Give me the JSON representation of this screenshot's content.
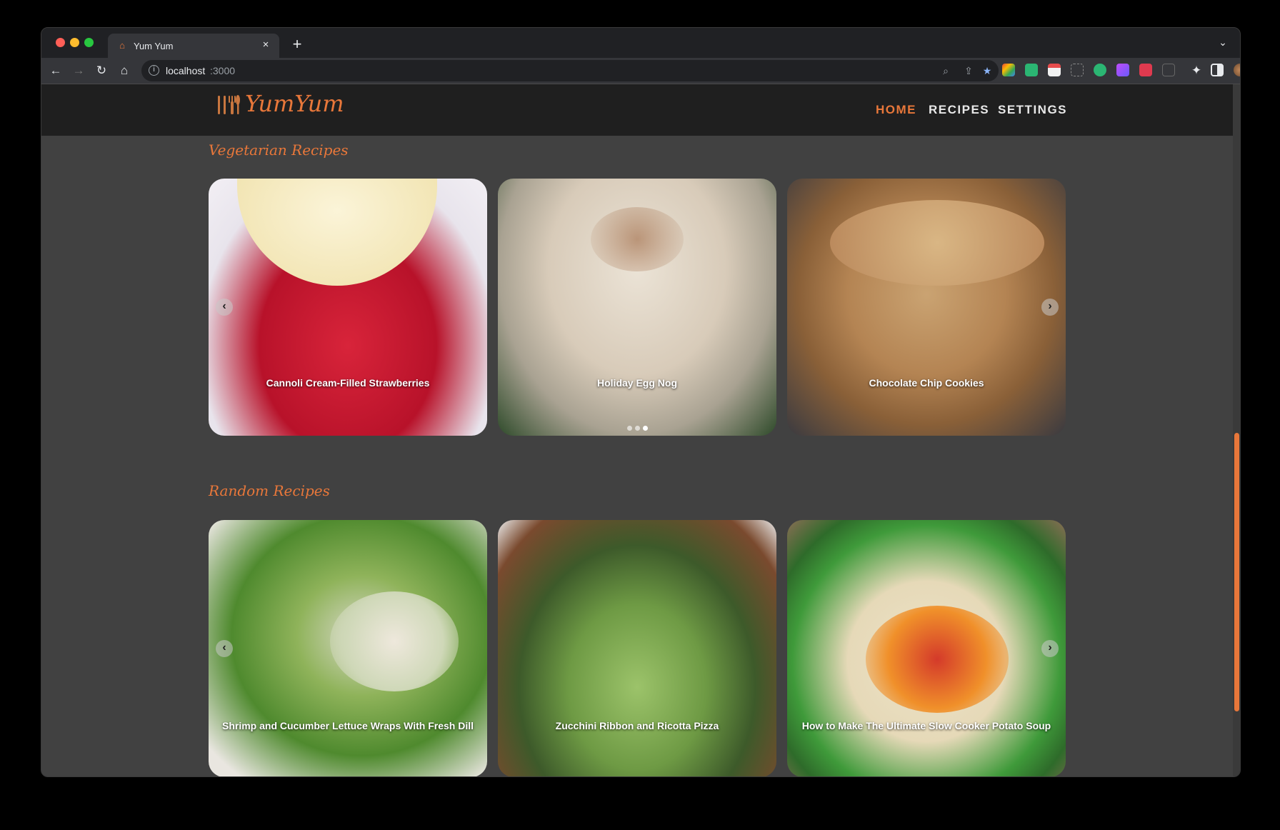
{
  "browser": {
    "tab_title": "Yum Yum",
    "tab_close": "×",
    "new_tab": "+",
    "address_host": "localhost",
    "address_port": ":3000"
  },
  "site": {
    "logo_text": "YumYum",
    "nav": [
      {
        "label": "HOME",
        "active": true
      },
      {
        "label": "RECIPES",
        "active": false
      },
      {
        "label": "SETTINGS",
        "active": false
      }
    ]
  },
  "sections": [
    {
      "title": "Vegetarian Recipes",
      "cards": [
        {
          "title": "Cannoli Cream-Filled Strawberries"
        },
        {
          "title": "Holiday Egg Nog"
        },
        {
          "title": "Chocolate Chip Cookies"
        }
      ]
    },
    {
      "title": "Random Recipes",
      "cards": [
        {
          "title": "Shrimp and Cucumber Lettuce Wraps With Fresh Dill"
        },
        {
          "title": "Zucchini Ribbon and Ricotta Pizza"
        },
        {
          "title": "How to Make The Ultimate Slow Cooker Potato Soup"
        }
      ]
    }
  ],
  "carousel": {
    "prev_icon": "‹",
    "next_icon": "›"
  },
  "colors": {
    "accent": "#e8773a",
    "header_bg": "#1f1f1f",
    "page_bg": "#414141"
  }
}
